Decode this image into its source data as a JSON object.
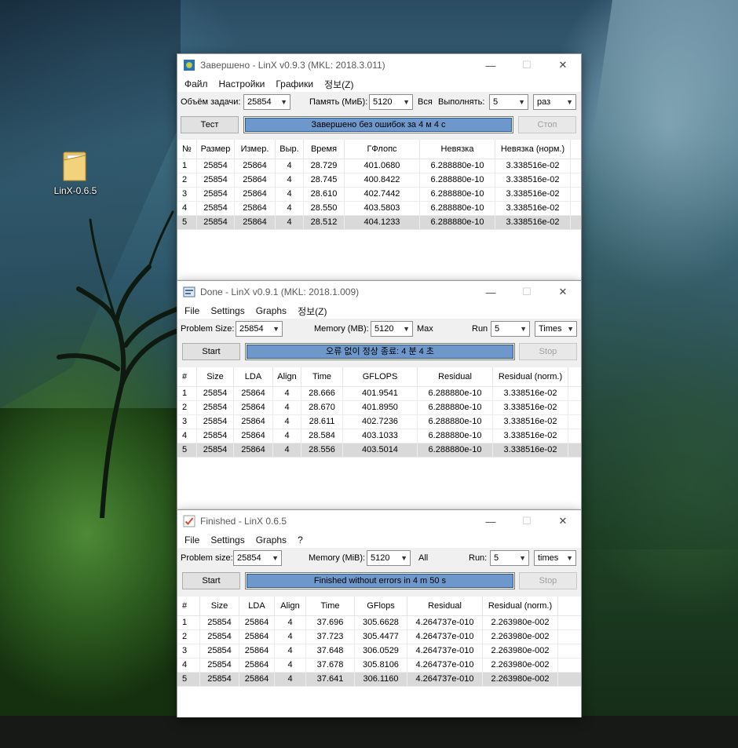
{
  "desktop": {
    "icon_label": "LinX-0.6.5"
  },
  "windows": [
    {
      "title": "Завершено - LinX v0.9.3 (MKL: 2018.3.011)",
      "menu": [
        "Файл",
        "Настройки",
        "Графики",
        "정보(Z)"
      ],
      "problem_size_label": "Объём задачи:",
      "problem_size_value": "25854",
      "memory_label": "Память (МиБ):",
      "memory_value": "5120",
      "memory_mode": "Вся",
      "run_label": "Выполнять:",
      "run_value": "5",
      "run_unit": "раз",
      "start_label": "Тест",
      "status": "Завершено без ошибок за 4 м 4 с",
      "stop_label": "Стоп",
      "columns": [
        "№",
        "Размер",
        "Измер.",
        "Выр.",
        "Время",
        "ГФлопс",
        "Невязка",
        "Невязка (норм.)"
      ],
      "rows": [
        [
          "1",
          "25854",
          "25864",
          "4",
          "28.729",
          "401.0680",
          "6.288880e-10",
          "3.338516e-02"
        ],
        [
          "2",
          "25854",
          "25864",
          "4",
          "28.745",
          "400.8422",
          "6.288880e-10",
          "3.338516e-02"
        ],
        [
          "3",
          "25854",
          "25864",
          "4",
          "28.610",
          "402.7442",
          "6.288880e-10",
          "3.338516e-02"
        ],
        [
          "4",
          "25854",
          "25864",
          "4",
          "28.550",
          "403.5803",
          "6.288880e-10",
          "3.338516e-02"
        ],
        [
          "5",
          "25854",
          "25864",
          "4",
          "28.512",
          "404.1233",
          "6.288880e-10",
          "3.338516e-02"
        ]
      ]
    },
    {
      "title": "Done - LinX v0.9.1 (MKL: 2018.1.009)",
      "menu": [
        "File",
        "Settings",
        "Graphs",
        "정보(Z)"
      ],
      "problem_size_label": "Problem Size:",
      "problem_size_value": "25854",
      "memory_label": "Memory (MB):",
      "memory_value": "5120",
      "memory_mode": "Max",
      "run_label": "Run",
      "run_value": "5",
      "run_unit": "Times",
      "start_label": "Start",
      "status": "오류 없이 정상 종료: 4 분 4 초",
      "stop_label": "Stop",
      "columns": [
        "#",
        "Size",
        "LDA",
        "Align",
        "Time",
        "GFLOPS",
        "Residual",
        "Residual (norm.)"
      ],
      "rows": [
        [
          "1",
          "25854",
          "25864",
          "4",
          "28.666",
          "401.9541",
          "6.288880e-10",
          "3.338516e-02"
        ],
        [
          "2",
          "25854",
          "25864",
          "4",
          "28.670",
          "401.8950",
          "6.288880e-10",
          "3.338516e-02"
        ],
        [
          "3",
          "25854",
          "25864",
          "4",
          "28.611",
          "402.7236",
          "6.288880e-10",
          "3.338516e-02"
        ],
        [
          "4",
          "25854",
          "25864",
          "4",
          "28.584",
          "403.1033",
          "6.288880e-10",
          "3.338516e-02"
        ],
        [
          "5",
          "25854",
          "25864",
          "4",
          "28.556",
          "403.5014",
          "6.288880e-10",
          "3.338516e-02"
        ]
      ]
    },
    {
      "title": "Finished - LinX 0.6.5",
      "menu": [
        "File",
        "Settings",
        "Graphs",
        "?"
      ],
      "problem_size_label": "Problem size:",
      "problem_size_value": "25854",
      "memory_label": "Memory (MiB):",
      "memory_value": "5120",
      "memory_mode": "All",
      "run_label": "Run:",
      "run_value": "5",
      "run_unit": "times",
      "start_label": "Start",
      "status": "Finished without errors in 4 m 50 s",
      "stop_label": "Stop",
      "columns": [
        "#",
        "Size",
        "LDA",
        "Align",
        "Time",
        "GFlops",
        "Residual",
        "Residual (norm.)"
      ],
      "rows": [
        [
          "1",
          "25854",
          "25864",
          "4",
          "37.696",
          "305.6628",
          "4.264737e-010",
          "2.263980e-002"
        ],
        [
          "2",
          "25854",
          "25864",
          "4",
          "37.723",
          "305.4477",
          "4.264737e-010",
          "2.263980e-002"
        ],
        [
          "3",
          "25854",
          "25864",
          "4",
          "37.648",
          "306.0529",
          "4.264737e-010",
          "2.263980e-002"
        ],
        [
          "4",
          "25854",
          "25864",
          "4",
          "37.678",
          "305.8106",
          "4.264737e-010",
          "2.263980e-002"
        ],
        [
          "5",
          "25854",
          "25864",
          "4",
          "37.641",
          "306.1160",
          "4.264737e-010",
          "2.263980e-002"
        ]
      ]
    }
  ],
  "icons": {
    "minimize": "minimize-icon",
    "maximize": "maximize-icon",
    "close": "close-icon",
    "dropdown": "chevron-down-icon"
  },
  "colors": {
    "progress_fill": "#6e98cc",
    "selected_row": "#d9d9d9"
  }
}
